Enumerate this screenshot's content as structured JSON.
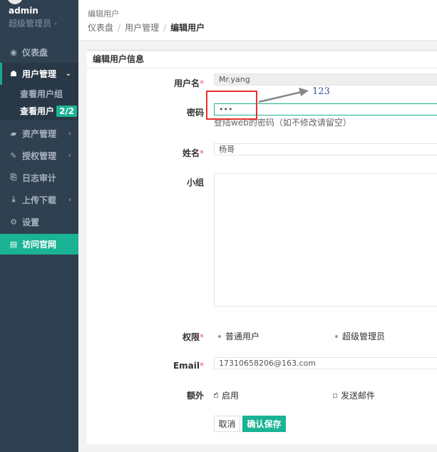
{
  "sidebar": {
    "user_name": "admin",
    "user_role": "超级管理员 -",
    "items": [
      {
        "icon": "dashboard-icon",
        "glyph": "◉",
        "label": "仪表盘"
      },
      {
        "icon": "users-icon",
        "glyph": "☗",
        "label": "用户管理",
        "caret": "⌄"
      },
      {
        "icon": "assets-icon",
        "glyph": "▰",
        "label": "资产管理",
        "caret": "‹"
      },
      {
        "icon": "edit-icon",
        "glyph": "✎",
        "label": "授权管理",
        "caret": "‹"
      },
      {
        "icon": "log-icon",
        "glyph": "⎘",
        "label": "日志审计"
      },
      {
        "icon": "download-icon",
        "glyph": "⤓",
        "label": "上传下载",
        "caret": "‹"
      },
      {
        "icon": "gear-icon",
        "glyph": "⚙",
        "label": "设置"
      },
      {
        "icon": "database-icon",
        "glyph": "▤",
        "label": "访问官网"
      }
    ],
    "sub_items": [
      {
        "label": "查看用户组"
      },
      {
        "label": "查看用户",
        "badge": "2/2"
      }
    ]
  },
  "header": {
    "page_title": "编辑用户",
    "breadcrumb": [
      "仪表盘",
      "用户管理",
      "编辑用户"
    ]
  },
  "panel": {
    "title": "编辑用户信息"
  },
  "form": {
    "username_label": "用户名",
    "username_value": "Mr.yang",
    "password_label": "密码",
    "password_value": "•••",
    "password_help": "登陆web的密码（如不修改请留空）",
    "name_label": "姓名",
    "name_value": "杨哥",
    "group_label": "小组",
    "role_label": "权限",
    "role_options": [
      "普通用户",
      "超级管理员"
    ],
    "email_label": "Email",
    "email_value": "17310658206@163.com",
    "extra_label": "额外",
    "extra_options": [
      "启用",
      "发送邮件"
    ],
    "required_mark": "*"
  },
  "buttons": {
    "cancel": "取消",
    "save": "确认保存"
  },
  "annotation": {
    "text": "123",
    "color": "#e8302a"
  },
  "colors": {
    "sidebar_bg": "#2f4050",
    "accent": "#1ab394"
  }
}
